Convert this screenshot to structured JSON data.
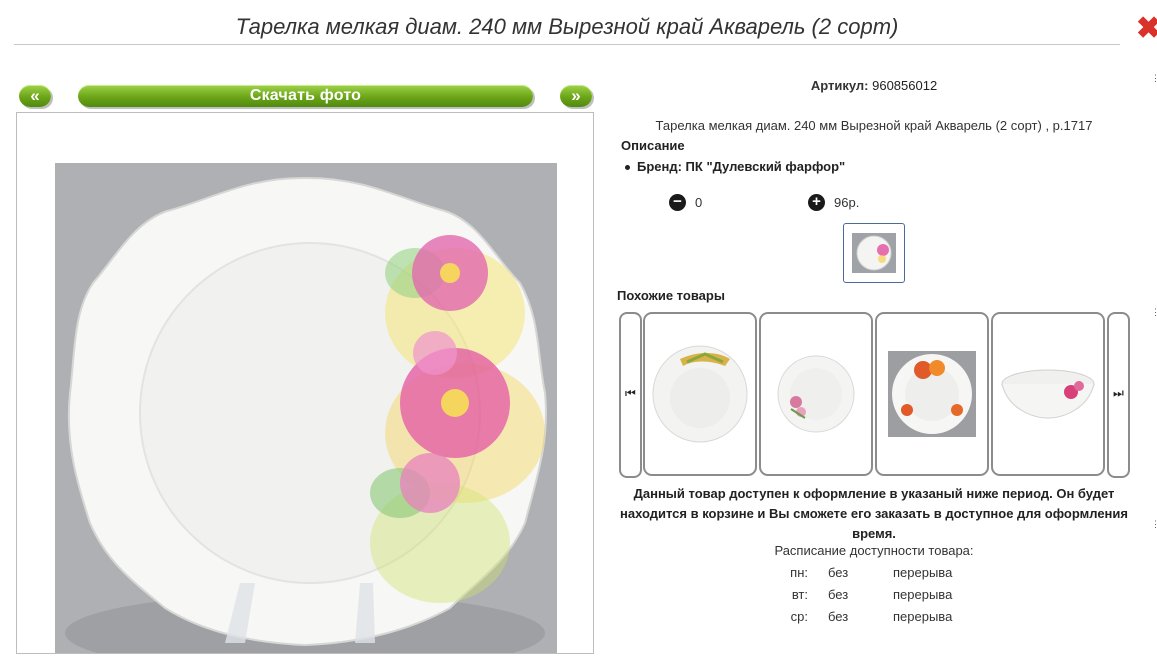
{
  "title": "Тарелка мелкая диам. 240 мм Вырезной край Акварель (2 сорт)",
  "gallery": {
    "prev_label": "«",
    "download_label": "Скачать фото",
    "next_label": "»"
  },
  "product": {
    "sku_label": "Артикул:",
    "sku_value": "960856012",
    "full_name": "Тарелка мелкая диам. 240 мм Вырезной край Акварель (2 сорт) , р.1717",
    "description_label": "Описание",
    "brand": "Бренд: ПК \"Дулевский фарфор\"",
    "quantity": "0",
    "price": "96р."
  },
  "similar": {
    "title": "Похожие товары",
    "prev_icon": "⏮",
    "next_icon": "⏭",
    "items": [
      "soup-plate-wheat",
      "plate-roses",
      "plate-apples",
      "bowl-roses"
    ]
  },
  "availability": {
    "notice": "Данный товар доступен к оформление в указаный ниже период. Он будет находится в корзине и Вы сможете его заказать в доступное для оформления время.",
    "schedule_title": "Расписание доступности товара:",
    "rows": [
      {
        "day": "пн:",
        "a": "без",
        "b": "перерыва"
      },
      {
        "day": "вт:",
        "a": "без",
        "b": "перерыва"
      },
      {
        "day": "ср:",
        "a": "без",
        "b": "перерыва"
      }
    ]
  },
  "colors": {
    "accent_green": "#6ca518",
    "close_red": "#d8322b"
  }
}
